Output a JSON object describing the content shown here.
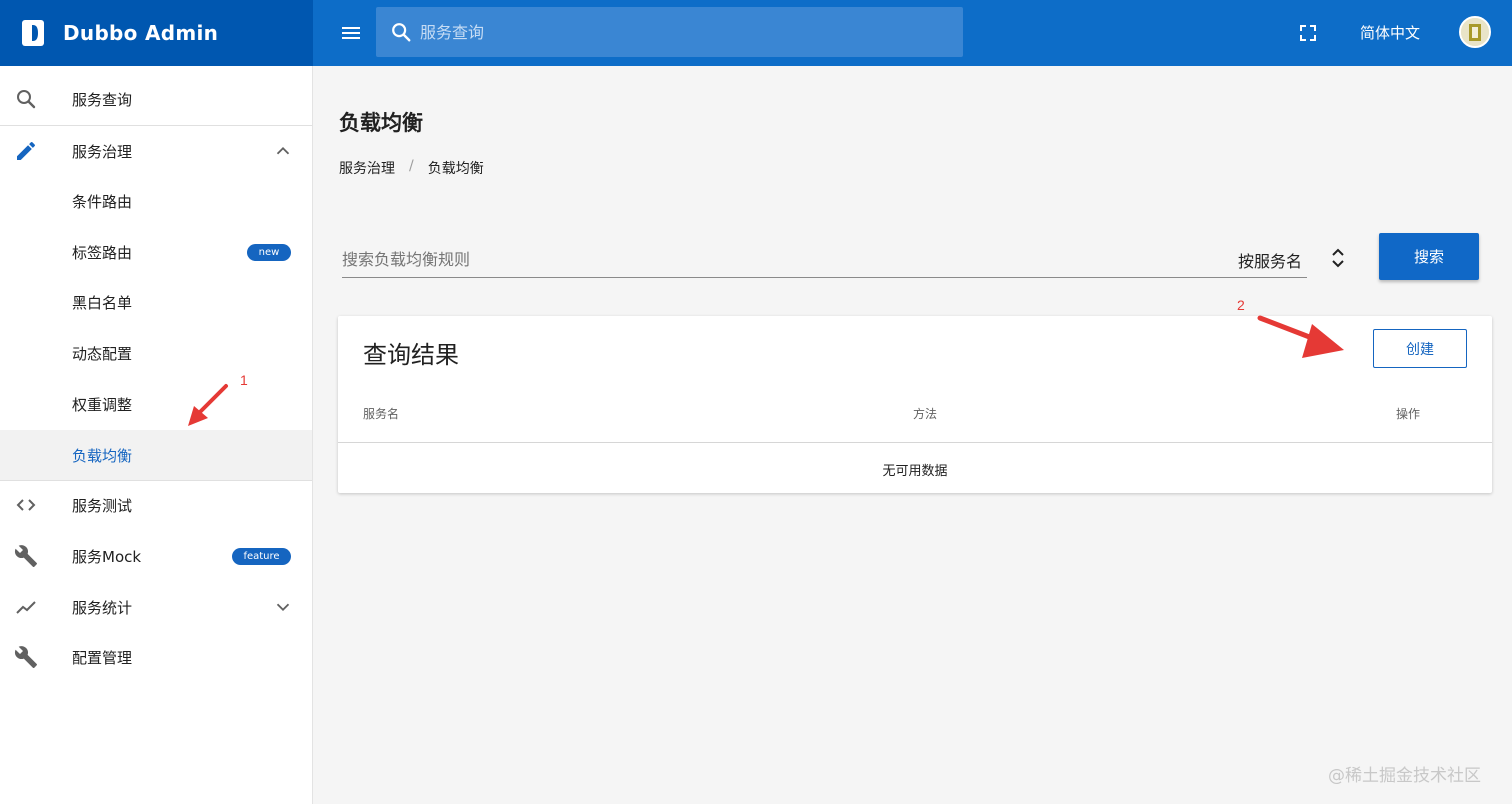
{
  "app": {
    "title": "Dubbo Admin"
  },
  "header": {
    "search_placeholder": "服务查询",
    "language": "简体中文"
  },
  "sidebar": {
    "items": [
      {
        "label": "服务查询",
        "icon": "search-icon"
      },
      {
        "label": "服务治理",
        "icon": "pencil-icon",
        "expanded": true
      },
      {
        "label": "条件路由"
      },
      {
        "label": "标签路由",
        "badge": "new"
      },
      {
        "label": "黑白名单"
      },
      {
        "label": "动态配置"
      },
      {
        "label": "权重调整"
      },
      {
        "label": "负载均衡",
        "active": true
      },
      {
        "label": "服务测试",
        "icon": "code-icon"
      },
      {
        "label": "服务Mock",
        "icon": "wrench-icon",
        "badge": "feature"
      },
      {
        "label": "服务统计",
        "icon": "trending-icon",
        "expanded": false
      },
      {
        "label": "配置管理",
        "icon": "wrench-icon"
      }
    ]
  },
  "main": {
    "title": "负载均衡",
    "breadcrumb": [
      "服务治理",
      "/",
      "负载均衡"
    ],
    "filter": {
      "placeholder": "搜索负载均衡规则",
      "select_value": "按服务名",
      "search_label": "搜索"
    },
    "results": {
      "title": "查询结果",
      "create_label": "创建",
      "columns": [
        "服务名",
        "方法",
        "操作"
      ],
      "empty_text": "无可用数据"
    }
  },
  "annotations": [
    "1",
    "2"
  ],
  "watermark": "@稀土掘金技术社区",
  "colors": {
    "brand_dark": "#0057b0",
    "brand": "#0d6dc8",
    "accent": "#1565c0",
    "annotation": "#e53935"
  }
}
